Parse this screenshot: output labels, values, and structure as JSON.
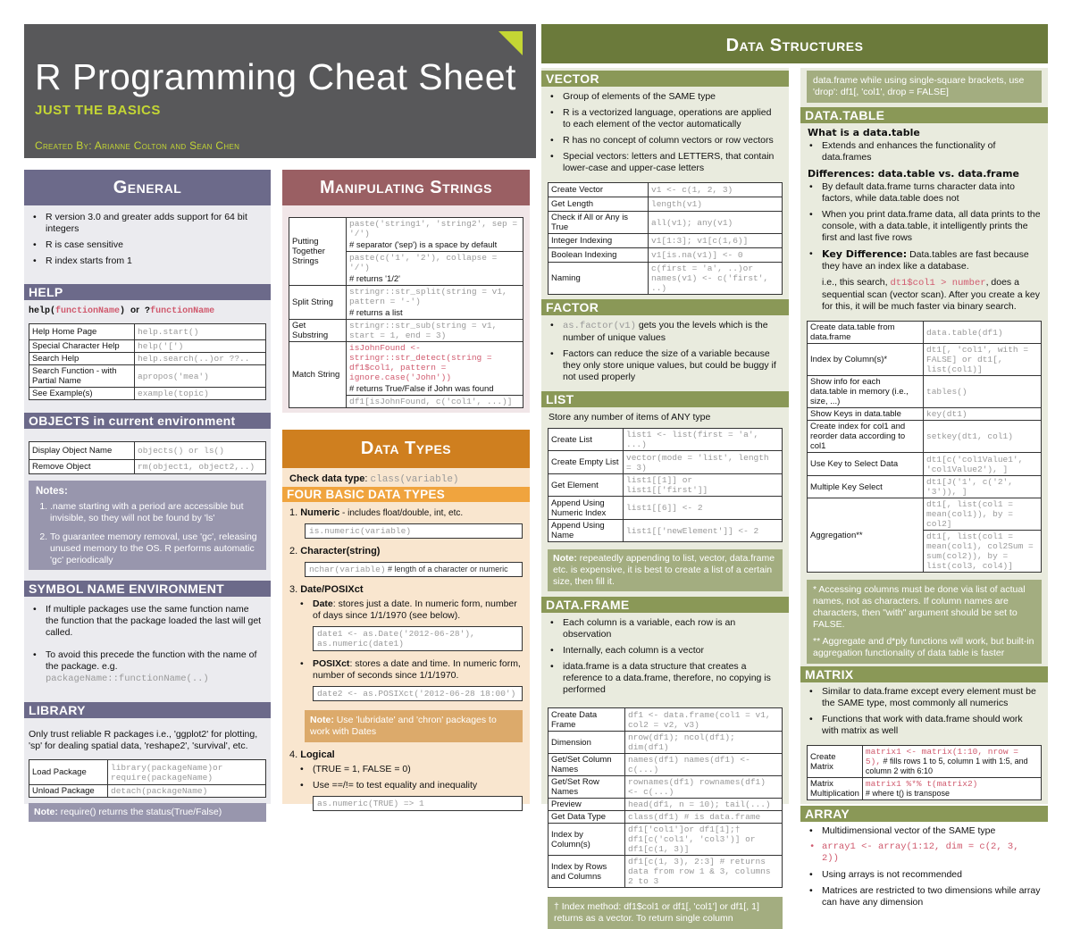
{
  "title": {
    "main": "R Programming Cheat Sheet",
    "subtitle": "JUST THE BASICS",
    "credits": "Created By: Arianne Colton and Sean Chen"
  },
  "colors": {
    "title_bg": "#58585a",
    "accent": "#c4d634",
    "general": "#6c6a8a",
    "strings": "#9a5f63",
    "datatypes": "#cf7f1f",
    "datastructures": "#6b7a3b",
    "structures_sub": "#8a9857"
  },
  "general": {
    "header": "General",
    "bullets": [
      "R version 3.0 and greater adds support for 64 bit integers",
      "R is case sensitive",
      "R index starts from 1"
    ],
    "help": {
      "header": "HELP",
      "syntax_a": "help(",
      "syntax_b": "functionName",
      "syntax_c": ") ",
      "syntax_or": "or",
      "syntax_d": " ?",
      "syntax_e": "functionName",
      "rows": [
        {
          "label": "Help Home Page",
          "code": "help.start()"
        },
        {
          "label": "Special Character Help",
          "code": "help('[')"
        },
        {
          "label": "Search Help",
          "code": "help.search(..)or ??.."
        },
        {
          "label": "Search Function - with Partial Name",
          "code": "apropos('mea')"
        },
        {
          "label": "See Example(s)",
          "code": "example(topic)"
        }
      ]
    },
    "objects": {
      "header": "OBJECTS in current environment",
      "rows": [
        {
          "label": "Display Object Name",
          "code": "objects() or ls()"
        },
        {
          "label": "Remove Object",
          "code": "rm(object1, object2,..)"
        }
      ],
      "notes_title": "Notes:",
      "notes": [
        ".name starting with a period are accessible but invisible, so they will not be found by 'ls'",
        "To guarantee memory removal,  use 'gc',  releasing unused memory to the OS. R performs automatic 'gc' periodically"
      ]
    },
    "symbol": {
      "header": "SYMBOL NAME ENVIRONMENT",
      "bullets": [
        "If multiple packages use the same function name the function that the package loaded the last will get called.",
        "To avoid this precede the function with the name of the package. e.g."
      ],
      "example_code": "packageName::functionName(..)"
    },
    "library": {
      "header": "LIBRARY",
      "text": "Only trust reliable R packages i.e., 'ggplot2' for plotting, 'sp' for dealing spatial data, 'reshape2', 'survival', etc.",
      "rows": [
        {
          "label": "Load Package",
          "code": "library(packageName)or require(packageName)"
        },
        {
          "label": "Unload Package",
          "code": "detach(packageName)"
        }
      ],
      "note_label": "Note:",
      "note_text": " require() returns the status(True/False)"
    }
  },
  "strings": {
    "header": "Manipulating Strings",
    "rows": [
      {
        "label": "Putting Together Strings",
        "codes": [
          "paste('string1', 'string2', sep = '/')",
          "# separator ('sep') is a space by default",
          "paste(c('1', '2'), collapse = '/')",
          "# returns '1/2'"
        ]
      },
      {
        "label": "Split String",
        "codes": [
          "stringr::str_split(string = v1, pattern = '-')",
          "# returns a list"
        ]
      },
      {
        "label": "Get Substring",
        "codes": [
          "stringr::str_sub(string = v1, start = 1, end = 3)"
        ]
      },
      {
        "label": "Match String",
        "codes": [
          "isJohnFound <- stringr::str_detect(string = df1$col1, pattern = ignore.case('John'))",
          "# returns True/False if John was found",
          "df1[isJohnFound, c('col1', ...)]"
        ]
      }
    ]
  },
  "datatypes": {
    "header": "Data Types",
    "check_label": "Check data type",
    "check_code": "class(variable)",
    "four_header": "FOUR BASIC DATA TYPES",
    "numeric_title": "Numeric",
    "numeric_desc": " - includes float/double, int, etc.",
    "numeric_code": "is.numeric(variable)",
    "char_title": "Character(string)",
    "char_code": "nchar(variable)",
    "char_comment": " # length of a character or numeric",
    "date_title": "Date/POSIXct",
    "date_label": "Date",
    "date_desc": ": stores just a date. In numeric form, number of days since 1/1/1970 (see below).",
    "date_code": "date1 <- as.Date('2012-06-28'), as.numeric(date1)",
    "posix_label": "POSIXct",
    "posix_desc": ": stores a date and time. In numeric form, number of seconds since 1/1/1970.",
    "posix_code": "date2 <- as.POSIXct('2012-06-28 18:00')",
    "note_label": "Note:",
    "note_text": " Use 'lubridate' and 'chron' packages to work with Dates",
    "logical_title": "Logical",
    "logical_bullets": [
      "(TRUE = 1, FALSE = 0)",
      "Use ==/!= to test equality and inequality"
    ],
    "logical_code": "as.numeric(TRUE) => 1"
  },
  "structures": {
    "header": "Data Structures",
    "vector": {
      "header": "VECTOR",
      "bullets": [
        "Group of elements of the SAME type",
        "R is a vectorized language, operations are applied to each element of the vector automatically",
        "R has no concept of column vectors or row vectors",
        "Special vectors: letters and LETTERS, that contain lower-case and upper-case letters"
      ],
      "rows": [
        {
          "label": "Create Vector",
          "code": "v1 <- c(1, 2, 3)"
        },
        {
          "label": "Get Length",
          "code": "length(v1)"
        },
        {
          "label": "Check if All or Any is True",
          "code": "all(v1); any(v1)"
        },
        {
          "label": "Integer Indexing",
          "code": "v1[1:3]; v1[c(1,6)]"
        },
        {
          "label": "Boolean Indexing",
          "code": "v1[is.na(v1)] <- 0"
        },
        {
          "label": "Naming",
          "code": "c(first = 'a', ..)or names(v1) <- c('first', ..)"
        }
      ]
    },
    "factor": {
      "header": "FACTOR",
      "code": "as.factor(v1)",
      "bullet1": " gets you the levels which is the number of unique values",
      "bullet2": "Factors can reduce the size of a variable because they only store unique values, but could be buggy if not used properly"
    },
    "list": {
      "header": "LIST",
      "text": "Store any number of items of ANY type",
      "rows": [
        {
          "label": "Create List",
          "code": "list1 <- list(first = 'a', ...)"
        },
        {
          "label": "Create Empty List",
          "code": "vector(mode = 'list', length = 3)"
        },
        {
          "label": "Get Element",
          "code": "list1[[1]] or list1[['first']]"
        },
        {
          "label": "Append Using Numeric Index",
          "code": "list1[[6]] <- 2"
        },
        {
          "label": "Append Using Name",
          "code": "list1[['newElement']] <- 2"
        }
      ],
      "note_label": "Note:",
      "note_text": " repeatedly appending to list, vector, data.frame etc. is expensive, it is best to  create a list of a certain size, then fill it."
    },
    "dataframe": {
      "header": "DATA.FRAME",
      "bullets": [
        "Each column is a variable, each row is an observation",
        "Internally, each column is a vector",
        "idata.frame is a data structure that creates a reference to a data.frame, therefore, no copying is performed"
      ],
      "rows": [
        {
          "label": "Create Data Frame",
          "code": "df1 <- data.frame(col1 = v1, col2 = v2, v3)"
        },
        {
          "label": "Dimension",
          "code": "nrow(df1); ncol(df1); dim(df1)"
        },
        {
          "label": "Get/Set Column Names",
          "code": "names(df1) names(df1) <- c(...)"
        },
        {
          "label": "Get/Set Row Names",
          "code": "rownames(df1) rownames(df1) <- c(...)"
        },
        {
          "label": "Preview",
          "code": "head(df1, n = 10); tail(...)"
        },
        {
          "label": "Get Data Type",
          "code": "class(df1)  # is data.frame"
        },
        {
          "label": "Index by Column(s)",
          "code": "df1['col1']or df1[1];† df1[c('col1', 'col3')] or df1[c(1, 3)]"
        },
        {
          "label": "Index by Rows and Columns",
          "code": "df1[c(1, 3), 2:3] # returns data from row 1 & 3, columns 2 to 3"
        }
      ],
      "footnote": "† Index method: df1$col1 or df1[, 'col1'] or df1[, 1] returns as a vector. To return single column",
      "footnote_cont": "data.frame while using single-square brackets, use 'drop': df1[, 'col1', drop = FALSE]"
    },
    "datatable": {
      "header": "DATA.TABLE",
      "what_title": "What is a data.table",
      "what_bullet": "Extends and enhances the functionality of data.frames",
      "diff_title": "Differences: data.table vs. data.frame",
      "diff_bullets": [
        "By default data.frame turns character data into factors, while data.table does not",
        "When you print data.frame data, all data prints to the console, with a data.table, it intelligently prints the first and last five rows"
      ],
      "key_label": "Key Difference:",
      "key_text": " Data.tables are fast because they have an index like a database.",
      "search_a": "i.e., this search, ",
      "search_code": "dt1$col1 > number",
      "search_b": ", does a sequential scan (vector scan). After you create a key for this, it will be much faster via binary search.",
      "rows": [
        {
          "label": "Create data.table from data.frame",
          "code": "data.table(df1)"
        },
        {
          "label": "Index by Column(s)*",
          "code": "dt1[, 'col1', with = FALSE] or dt1[, list(col1)]"
        },
        {
          "label": "Show info for each data.table in memory (i.e., size, ...)",
          "code": "tables()"
        },
        {
          "label": "Show Keys in data.table",
          "code": "key(dt1)"
        },
        {
          "label": "Create index for col1 and reorder data according to col1",
          "code": "setkey(dt1, col1)"
        },
        {
          "label": "Use Key to Select Data",
          "code": "dt1[c('col1Value1', 'col1Value2'), ]"
        },
        {
          "label": "Multiple Key Select",
          "code": "dt1[J('1', c('2', '3')), ]"
        },
        {
          "label": "Aggregation**",
          "code": "dt1[, list(col1 = mean(col1)), by = col2]"
        },
        {
          "label": "",
          "code": "dt1[, list(col1 = mean(col1), col2Sum = sum(col2)), by = list(col3, col4)]"
        }
      ],
      "note1": "* Accessing columns must be done via list of actual names, not as characters. If column names are characters, then \"with\" argument should be set to FALSE.",
      "note2": "** Aggregate and d*ply functions will work, but built-in aggregation functionality of data table is faster"
    },
    "matrix": {
      "header": "MATRIX",
      "bullets": [
        "Similar to data.frame except every element must be the SAME type, most commonly all numerics",
        "Functions that work with data.frame should work with matrix as well"
      ],
      "rows": [
        {
          "label": "Create Matrix",
          "code": "matrix1 <- matrix(1:10, nrow = 5),",
          "comment": " # fills rows 1 to 5, column 1 with 1:5, and column 2 with 6:10"
        },
        {
          "label": "Matrix Multiplication",
          "code": "matrix1 %*% t(matrix2)",
          "comment": " #  where t() is transpose"
        }
      ]
    },
    "array": {
      "header": "ARRAY",
      "bullets": [
        "Multidimensional vector of the SAME type",
        "array1 <- array(1:12, dim = c(2, 3, 2))",
        "Using arrays is not recommended",
        "Matrices are restricted to two dimensions while array can have any dimension"
      ]
    }
  }
}
